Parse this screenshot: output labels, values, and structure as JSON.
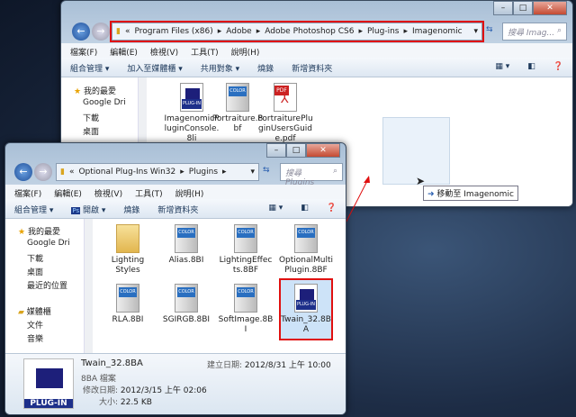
{
  "back_window": {
    "address": [
      "«",
      "Program Files (x86)",
      "Adobe",
      "Adobe Photoshop CS6",
      "Plug-ins",
      "Imagenomic"
    ],
    "search_placeholder": "搜尋 Imag...",
    "menu": [
      "檔案(F)",
      "編輯(E)",
      "檢視(V)",
      "工具(T)",
      "說明(H)"
    ],
    "toolbar": [
      "組合管理 ▾",
      "加入至媒體櫃 ▾",
      "共用對象 ▾",
      "燒錄",
      "新增資料夾"
    ],
    "sidebar": [
      "我的最愛",
      "Google Dri",
      "下載",
      "桌面"
    ],
    "files": [
      {
        "name": "ImagenomicPluginConsole.8li",
        "icon": "plugin"
      },
      {
        "name": "Portraiture.8bf",
        "icon": "color"
      },
      {
        "name": "PortraiturePluginUsersGuide.pdf",
        "icon": "pdf"
      }
    ]
  },
  "drag_tooltip": "移動至 Imagenomic",
  "front_window": {
    "address": [
      "«",
      "Optional Plug-Ins Win32",
      "Plugins"
    ],
    "search_placeholder": "搜尋 Plugins",
    "menu": [
      "檔案(F)",
      "編輯(E)",
      "檢視(V)",
      "工具(T)",
      "說明(H)"
    ],
    "toolbar": [
      "組合管理 ▾",
      "開啟 ▾",
      "燒錄",
      "新增資料夾"
    ],
    "sidebar": [
      "我的最愛",
      "Google Dri",
      "下載",
      "桌面",
      "最近的位置",
      "媒體櫃",
      "文件",
      "音樂"
    ],
    "files": [
      {
        "name": "Lighting Styles",
        "icon": "folder"
      },
      {
        "name": "Alias.8BI",
        "icon": "color"
      },
      {
        "name": "LightingEffects.8BF",
        "icon": "color"
      },
      {
        "name": "OptionalMultiPlugin.8BF",
        "icon": "color"
      },
      {
        "name": "RLA.8BI",
        "icon": "color"
      },
      {
        "name": "SGIRGB.8BI",
        "icon": "color"
      },
      {
        "name": "SoftImage.8BI",
        "icon": "color"
      },
      {
        "name": "Twain_32.8BA",
        "icon": "plugin",
        "selected": true
      }
    ],
    "details": {
      "name": "Twain_32.8BA",
      "type": "8BA 檔案",
      "modified_label": "修改日期:",
      "modified": "2012/3/15 上午 02:06",
      "size_label": "大小:",
      "size": "22.5 KB",
      "created_label": "建立日期:",
      "created": "2012/8/31 上午 10:00",
      "icon_label": "PLUG-IN"
    }
  },
  "colors": {
    "highlight": "#e01010",
    "selection": "#cde3f8"
  }
}
